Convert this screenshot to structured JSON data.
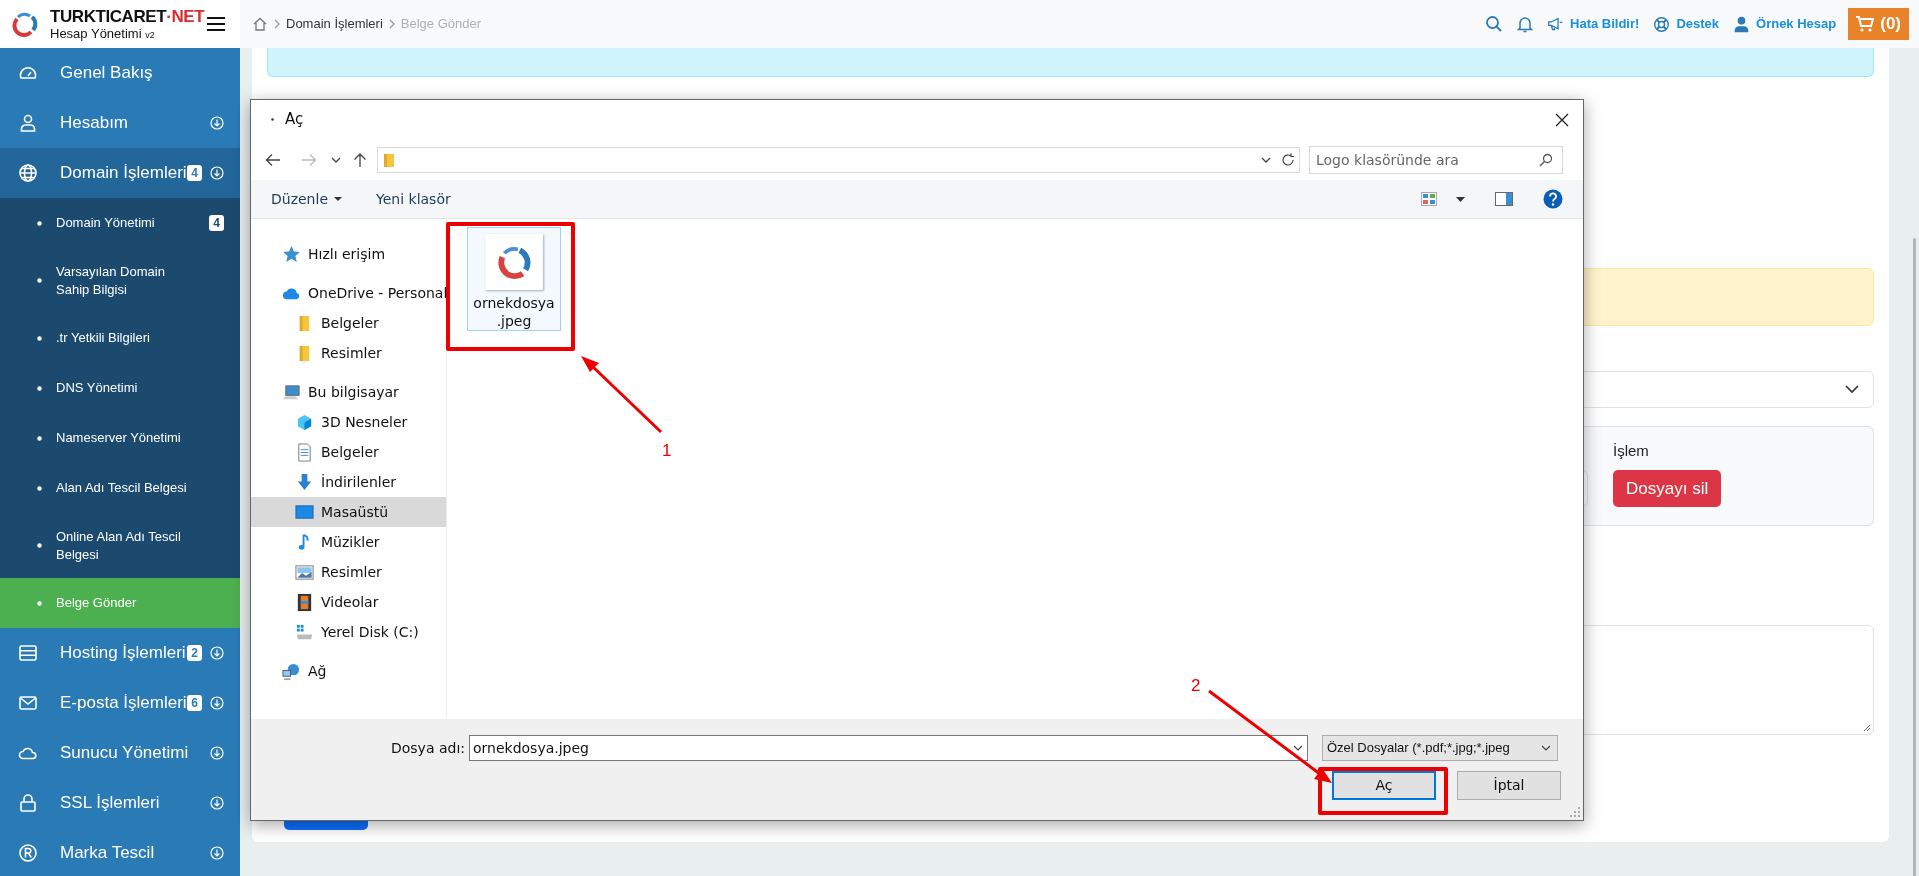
{
  "brand": {
    "name": "TURKTICARET",
    "name_accent": "·NET",
    "subtitle": "Hesap Yönetimi",
    "version": "v2"
  },
  "sidebar": {
    "items": [
      {
        "label": "Genel Bakış",
        "toggle": false,
        "expanded": false
      },
      {
        "label": "Hesabım",
        "toggle": true,
        "expanded": false
      },
      {
        "label": "Domain İşlemleri",
        "badge": "4",
        "toggle": true,
        "expanded": true,
        "children": [
          {
            "label": "Domain Yönetimi",
            "badge": "4",
            "selected": false
          },
          {
            "label": "Varsayılan Domain Sahip Bilgisi",
            "selected": false
          },
          {
            "label": ".tr Yetkili Bilgileri",
            "selected": false
          },
          {
            "label": "DNS Yönetimi",
            "selected": false
          },
          {
            "label": "Nameserver Yönetimi",
            "selected": false
          },
          {
            "label": "Alan Adı Tescil Belgesi",
            "selected": false
          },
          {
            "label": "Online Alan Adı Tescil Belgesi",
            "selected": false
          },
          {
            "label": "Belge Gönder",
            "selected": true
          }
        ]
      },
      {
        "label": "Hosting İşlemleri",
        "badge": "2",
        "toggle": true,
        "expanded": false
      },
      {
        "label": "E-posta İşlemleri",
        "badge": "6",
        "toggle": true,
        "expanded": false
      },
      {
        "label": "Sunucu Yönetimi",
        "toggle": true,
        "expanded": false
      },
      {
        "label": "SSL İşlemleri",
        "toggle": true,
        "expanded": false
      },
      {
        "label": "Marka Tescil",
        "toggle": true,
        "expanded": false
      }
    ]
  },
  "breadcrumb": [
    {
      "label": "Domain İşlemleri",
      "current": false
    },
    {
      "label": "Belge Gönder",
      "current": true
    }
  ],
  "topbar": {
    "links": [
      "Hata Bildir!",
      "Destek",
      "Örnek Hesap"
    ],
    "cart": "(0)"
  },
  "page": {
    "column_label": "İşlem",
    "delete_button": "Dosyayı sil"
  },
  "dialog": {
    "title": "Aç",
    "search_placeholder": "Logo klasöründe ara",
    "toolbar": [
      "Düzenle",
      "Yeni klasör"
    ],
    "tree": [
      {
        "label": "Hızlı erişim",
        "selected": false
      },
      {
        "label": "OneDrive - Personal",
        "selected": false,
        "children": [
          {
            "label": "Belgeler",
            "selected": false
          },
          {
            "label": "Resimler",
            "selected": false
          }
        ]
      },
      {
        "label": "Bu bilgisayar",
        "selected": false,
        "children": [
          {
            "label": "3D Nesneler",
            "selected": false
          },
          {
            "label": "Belgeler",
            "selected": false
          },
          {
            "label": "İndirilenler",
            "selected": false
          },
          {
            "label": "Masaüstü",
            "selected": true
          },
          {
            "label": "Müzikler",
            "selected": false
          },
          {
            "label": "Resimler",
            "selected": false
          },
          {
            "label": "Videolar",
            "selected": false
          },
          {
            "label": "Yerel Disk (C:)",
            "selected": false
          }
        ]
      },
      {
        "label": "Ağ",
        "selected": false
      }
    ],
    "files": [
      {
        "name": "ornekdosya.jpeg",
        "selected": true
      }
    ],
    "filename_label": "Dosya adı:",
    "filename": "ornekdosya.jpeg",
    "filetype": "Özel Dosyalar (*.pdf;*.jpg;*.jpeg",
    "buttons": [
      {
        "label": "Aç",
        "default": true
      },
      {
        "label": "İptal",
        "default": false
      }
    ]
  },
  "annotations": [
    {
      "label": "1"
    },
    {
      "label": "2"
    }
  ]
}
